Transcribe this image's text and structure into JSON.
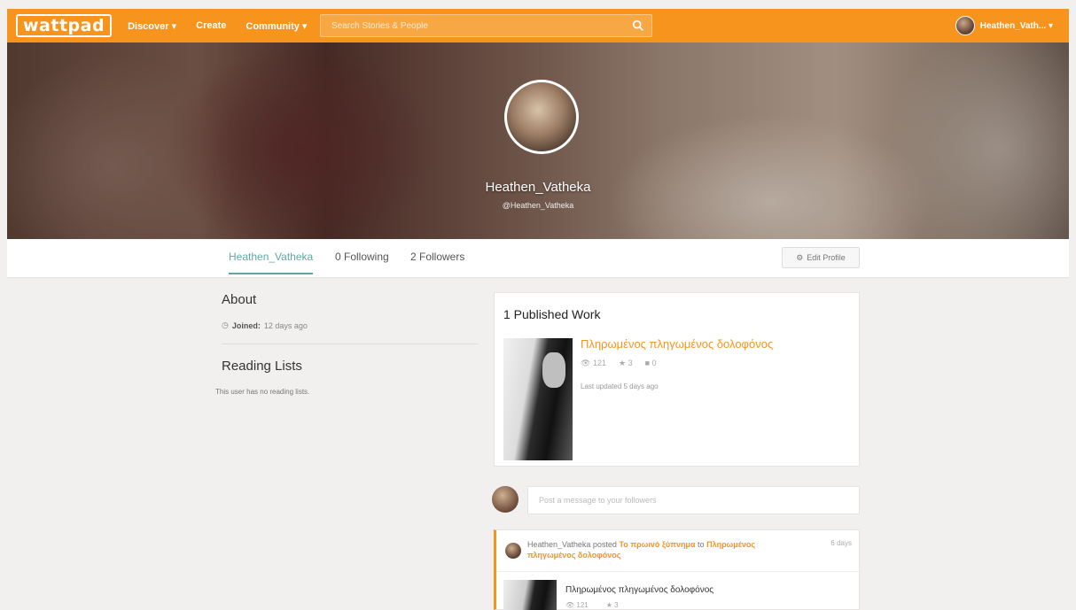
{
  "nav": {
    "logo": "wattpad",
    "discover": "Discover",
    "create": "Create",
    "community": "Community",
    "search_placeholder": "Search Stories & People",
    "username": "Heathen_Vath...",
    "accent_color": "#f7941d"
  },
  "profile": {
    "display_name": "Heathen_Vatheka",
    "handle": "@Heathen_Vatheka"
  },
  "tabs": {
    "name": "Heathen_Vatheka",
    "following": "0 Following",
    "followers": "2 Followers",
    "edit_profile": "Edit Profile"
  },
  "about": {
    "title": "About",
    "joined_label": "Joined:",
    "joined_value": "12 days ago"
  },
  "reading_lists": {
    "title": "Reading Lists",
    "empty": "This user has no reading lists."
  },
  "published": {
    "title": "1 Published Work",
    "story_title": "Πληρωμένος πληγωμένος δολοφόνος",
    "reads": "121",
    "votes": "3",
    "comments": "0",
    "updated": "Last updated 5 days ago"
  },
  "message": {
    "placeholder": "Post a message to your followers"
  },
  "activity": {
    "user": "Heathen_Vatheka",
    "verb": "posted",
    "part": "Το πρωινό ξύπνημα",
    "to": "to",
    "story": "Πληρωμένος πληγωμένος δολοφόνος",
    "time": "6 days",
    "mini_title": "Πληρωμένος πληγωμένος δολοφόνος",
    "mini_reads": "121",
    "mini_votes": "3"
  }
}
